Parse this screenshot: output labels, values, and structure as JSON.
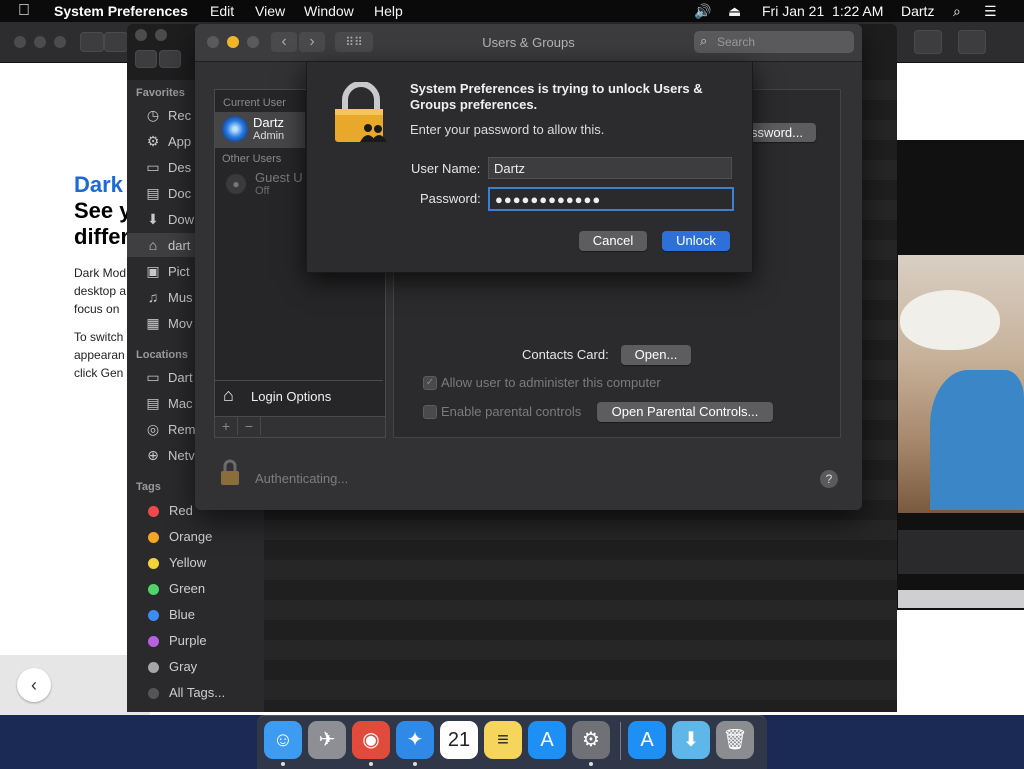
{
  "menubar": {
    "app_name": "System Preferences",
    "items": [
      "Edit",
      "View",
      "Window",
      "Help"
    ],
    "datetime": "Fri Jan 21  1:22 AM",
    "user": "Dartz"
  },
  "background_page": {
    "title": "Dark",
    "line1": "See y",
    "line2": "differ",
    "para1": [
      "Dark Mod",
      "desktop a",
      "focus on"
    ],
    "para2": [
      "To switch",
      "appearan",
      "click Gen"
    ],
    "back_glyph": "‹"
  },
  "finder": {
    "favorites_header": "Favorites",
    "favorites": [
      "Rec",
      "App",
      "Des",
      "Doc",
      "Dow",
      "dart",
      "Pict",
      "Mus",
      "Mov"
    ],
    "locations_header": "Locations",
    "locations": [
      "Dart",
      "Mac",
      "Rem",
      "Netv"
    ],
    "tags_header": "Tags",
    "tags": [
      {
        "label": "Red",
        "color": "#ef4a49"
      },
      {
        "label": "Orange",
        "color": "#f5a623"
      },
      {
        "label": "Yellow",
        "color": "#f4d23a"
      },
      {
        "label": "Green",
        "color": "#4fd36a"
      },
      {
        "label": "Blue",
        "color": "#3b8cf4"
      },
      {
        "label": "Purple",
        "color": "#b662e0"
      },
      {
        "label": "Gray",
        "color": "#a6a6a8"
      },
      {
        "label": "All Tags...",
        "color": "#555557"
      }
    ]
  },
  "sysprefs": {
    "window_title": "Users & Groups",
    "search_placeholder": "Search",
    "current_user_header": "Current User",
    "current_user_name": "Dartz",
    "current_user_role": "Admin",
    "other_users_header": "Other Users",
    "guest_name": "Guest U",
    "guest_status": "Off",
    "login_options": "Login Options",
    "add_glyph": "+",
    "remove_glyph": "−",
    "change_password_partial": "ssword...",
    "contacts_card_label": "Contacts Card:",
    "open_button": "Open...",
    "allow_admin_label": "Allow user to administer this computer",
    "parental_label": "Enable parental controls",
    "open_parental_button": "Open Parental Controls...",
    "authenticating": "Authenticating...",
    "help_glyph": "?"
  },
  "sheet": {
    "title": "System Preferences is trying to unlock Users & Groups preferences.",
    "subtitle": "Enter your password to allow this.",
    "username_label": "User Name:",
    "username_value": "Dartz",
    "password_label": "Password:",
    "password_value": "●●●●●●●●●●●●",
    "cancel": "Cancel",
    "unlock": "Unlock"
  },
  "dock": {
    "apps": [
      {
        "name": "finder-icon",
        "glyph": "☺",
        "color": "#3d9cf2"
      },
      {
        "name": "launchpad-icon",
        "glyph": "✈",
        "color": "#8d8f95"
      },
      {
        "name": "chrome-icon",
        "glyph": "◉",
        "color": "#e04b3b"
      },
      {
        "name": "safari-icon",
        "glyph": "✦",
        "color": "#2e8ae6"
      },
      {
        "name": "calendar-icon",
        "glyph": "21",
        "color": "#ffffff"
      },
      {
        "name": "notes-icon",
        "glyph": "≡",
        "color": "#f6d55c"
      },
      {
        "name": "app-store-icon",
        "glyph": "A",
        "color": "#1e90f5"
      },
      {
        "name": "system-preferences-icon",
        "glyph": "⚙",
        "color": "#6f7176"
      },
      {
        "name": "app-store-downloads-icon",
        "glyph": "A",
        "color": "#1e90f5"
      },
      {
        "name": "downloads-folder-icon",
        "glyph": "⬇",
        "color": "#5fb6e8"
      },
      {
        "name": "trash-icon",
        "glyph": "🗑",
        "color": "#8a8c90"
      }
    ]
  }
}
